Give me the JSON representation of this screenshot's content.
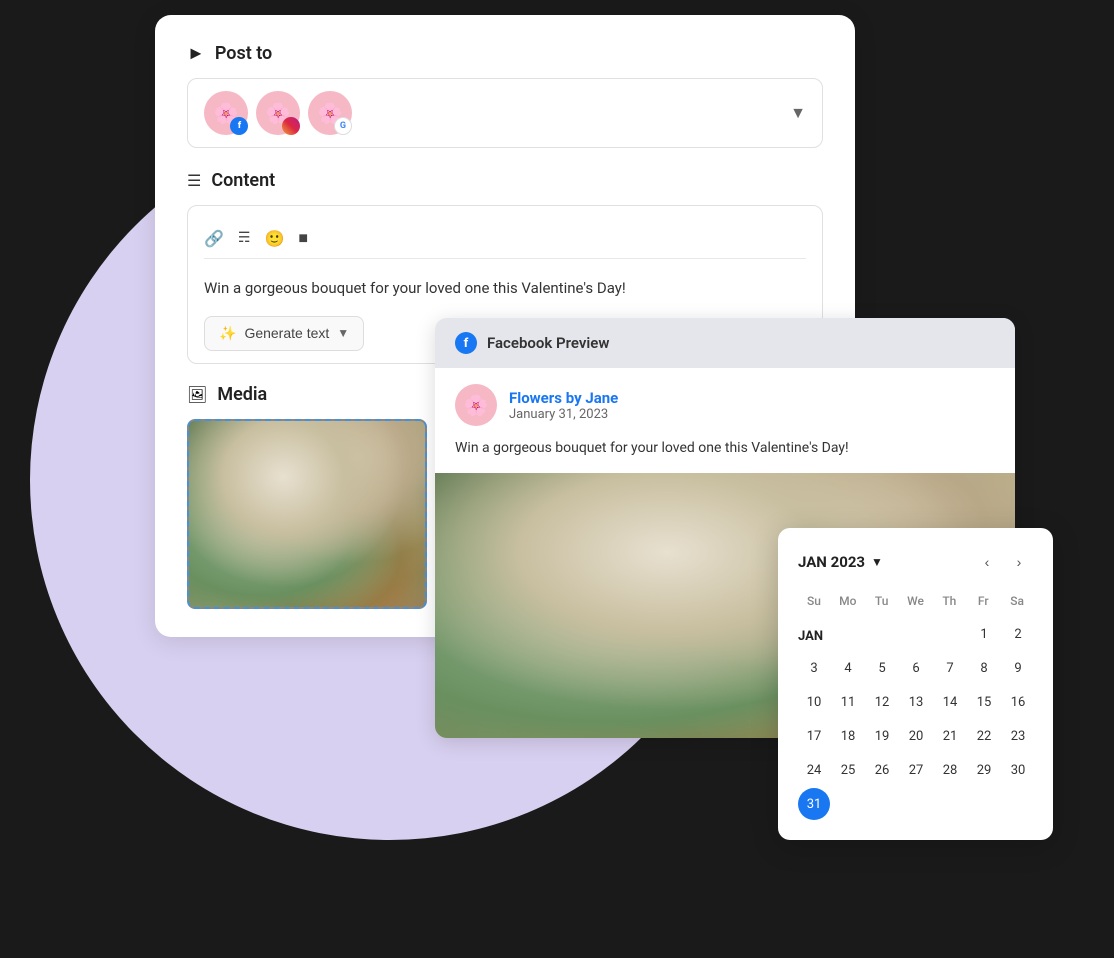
{
  "background": {
    "circle_color": "#d8d0f0"
  },
  "post_card": {
    "title": "Post to",
    "section_icon": "▶",
    "accounts": [
      {
        "type": "facebook",
        "emoji": "🌸",
        "badge": "f"
      },
      {
        "type": "instagram",
        "emoji": "🌸",
        "badge": "ig"
      },
      {
        "type": "google",
        "emoji": "🌸",
        "badge": "G"
      }
    ],
    "content_label": "Content",
    "content_text": "Win a gorgeous bouquet for your loved one this Valentine's Day!",
    "generate_btn_label": "Generate text",
    "media_label": "Media"
  },
  "fb_preview": {
    "header_label": "Facebook Preview",
    "account_name": "Flowers by Jane",
    "date": "January 31, 2023",
    "post_text": "Win a gorgeous bouquet for your loved one this Valentine's Day!"
  },
  "calendar": {
    "month_year": "JAN 2023",
    "weekdays": [
      "Su",
      "Mo",
      "Tu",
      "We",
      "Th",
      "Fr",
      "Sa"
    ],
    "month_label": "JAN",
    "weeks": [
      [
        null,
        null,
        null,
        null,
        null,
        null,
        null
      ],
      [
        1,
        2,
        3,
        4,
        5,
        6,
        7
      ],
      [
        8,
        9,
        10,
        11,
        12,
        13,
        14
      ],
      [
        15,
        16,
        17,
        18,
        19,
        20,
        21
      ],
      [
        22,
        23,
        24,
        25,
        26,
        27,
        28
      ],
      [
        29,
        30,
        31,
        null,
        null,
        null,
        null
      ]
    ],
    "selected_day": 31,
    "rows": [
      {
        "label": "JAN",
        "days": [
          null,
          null,
          null,
          null,
          null,
          null,
          null
        ]
      },
      {
        "label": "",
        "days": [
          null,
          null,
          null,
          null,
          1,
          2,
          3
        ]
      },
      {
        "label": "",
        "days": [
          4,
          5,
          6,
          7,
          8,
          9,
          10
        ]
      },
      {
        "label": "",
        "days": [
          11,
          12,
          13,
          14,
          15,
          16,
          17
        ]
      },
      {
        "label": "",
        "days": [
          18,
          19,
          20,
          21,
          22,
          23,
          24
        ]
      },
      {
        "label": "",
        "days": [
          25,
          26,
          27,
          28,
          29,
          30,
          31
        ]
      }
    ]
  }
}
